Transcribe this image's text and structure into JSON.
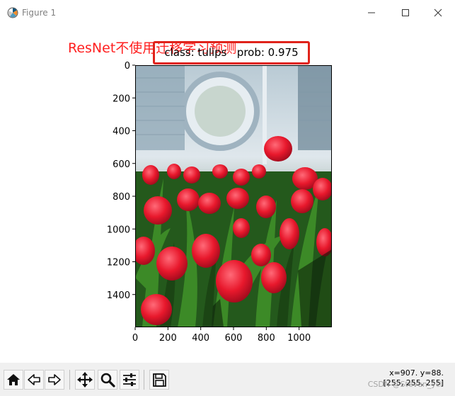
{
  "window": {
    "title": "Figure 1",
    "icon": "matplotlib-icon",
    "controls": [
      "minimize-icon",
      "maximize-icon",
      "close-icon"
    ]
  },
  "annotation": {
    "text": "ResNet不使用迁移学习预测",
    "color": "#ff1f1f"
  },
  "plot": {
    "title": "class: tulips   prob: 0.975",
    "highlight_color": "#e0231b",
    "image": {
      "subject": "red tulips in front of a greenhouse window",
      "colors": {
        "petal": "#e8182c",
        "petal_light": "#ff4a5c",
        "petal_dark": "#a00a1c",
        "stem": "#2e7d1f",
        "leaf_dark": "#1a4a15",
        "background_window": "#c9d6de",
        "background_frame": "#8aa2b2"
      }
    },
    "axes": {
      "xticks": [
        "0",
        "200",
        "400",
        "600",
        "800",
        "1000"
      ],
      "yticks": [
        "0",
        "200",
        "400",
        "600",
        "800",
        "1000",
        "1200",
        "1400"
      ],
      "x_values": [
        0,
        200,
        400,
        600,
        800,
        1000
      ],
      "y_values": [
        0,
        200,
        400,
        600,
        800,
        1000,
        1200,
        1400
      ],
      "xlim": [
        0,
        1200
      ],
      "ylim": [
        1600,
        0
      ]
    }
  },
  "toolbar": {
    "tools": [
      {
        "name": "home-icon"
      },
      {
        "name": "back-icon"
      },
      {
        "name": "forward-icon"
      },
      {
        "name": "pan-icon"
      },
      {
        "name": "zoom-icon"
      },
      {
        "name": "configure-subplots-icon"
      },
      {
        "name": "save-icon"
      }
    ]
  },
  "status": {
    "coords": "x=907. y=88.",
    "pixel_value": "[255, 255, 255]"
  },
  "watermark": "CSDN @Steven_ycl"
}
